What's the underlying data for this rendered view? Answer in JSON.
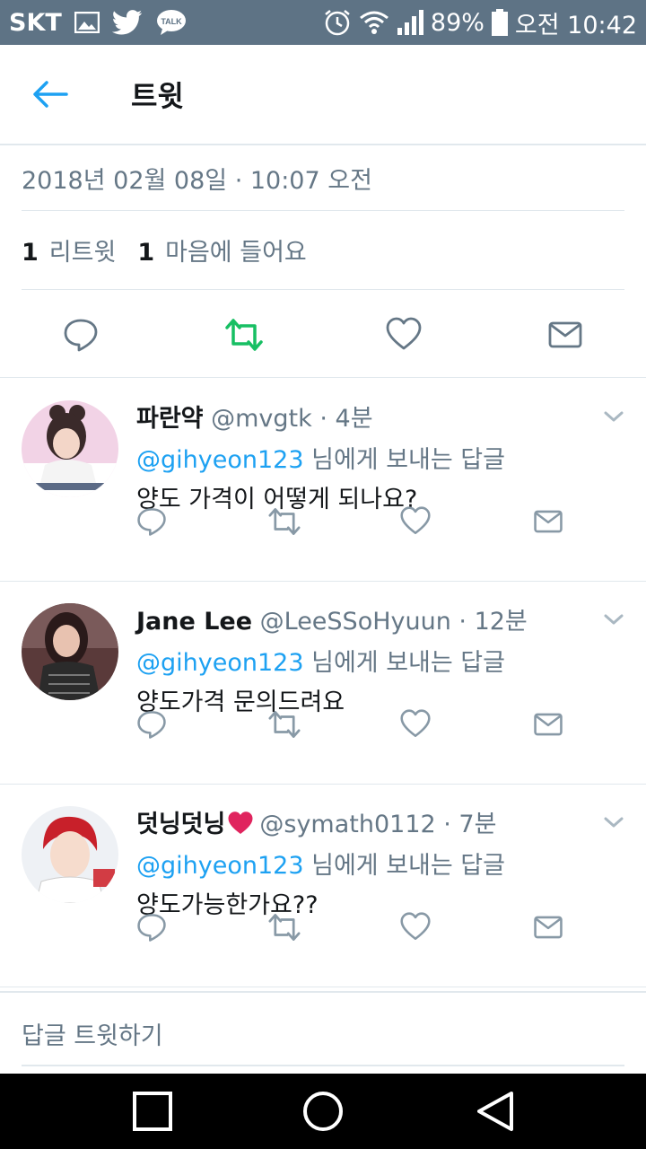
{
  "status_bar": {
    "carrier": "SKT",
    "talk_label": "TALK",
    "battery": "89%",
    "time": "오전 10:42",
    "left_icons": [
      "image-icon",
      "twitter-bird-icon",
      "kakaotalk-icon"
    ],
    "right_icons": [
      "alarm-icon",
      "wifi-icon",
      "signal-icon",
      "battery-icon"
    ]
  },
  "header": {
    "title": "트윗"
  },
  "tweet": {
    "timestamp": "2018년 02월 08일 · 10:07 오전",
    "retweet_count": "1",
    "retweet_label": "리트윗",
    "like_count": "1",
    "like_label": "마음에 들어요",
    "retweeted": true,
    "accent_retweet": "#17bf63"
  },
  "replies": [
    {
      "name": "파란약",
      "handle": "@mvgtk · 4분",
      "mention": "@gihyeon123",
      "to_suffix": " 님에게 보내는 답글",
      "text": "양도 가격이 어떻게 되나요?"
    },
    {
      "name": "Jane Lee",
      "handle": "@LeeSSoHyuun · 12분",
      "mention": "@gihyeon123",
      "to_suffix": " 님에게 보내는 답글",
      "text": "양도가격 문의드려요"
    },
    {
      "name": "덧닝덧닝",
      "handle": "@symath0112 · 7분",
      "mention": "@gihyeon123",
      "to_suffix": " 님에게 보내는 답글",
      "text": "양도가능한가요??"
    }
  ],
  "compose": {
    "placeholder": "답글 트윗하기"
  },
  "colors": {
    "status_bar": "#5e7385",
    "link": "#1da1f2",
    "muted": "#657786",
    "heart_emoji": "#e0245e"
  }
}
